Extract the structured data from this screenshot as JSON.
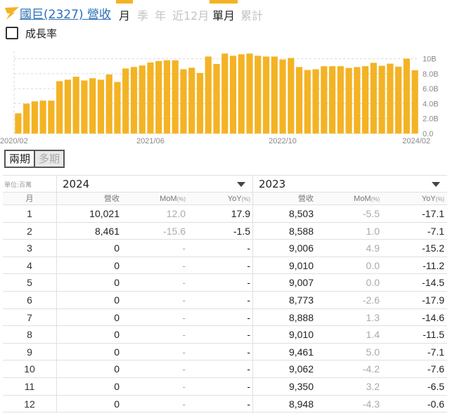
{
  "header": {
    "company": "國巨(2327) 營收",
    "tabs": [
      {
        "label": "月",
        "active": true
      },
      {
        "label": "季",
        "active": false
      },
      {
        "label": "年",
        "active": false
      },
      {
        "label": "近12月",
        "active": false
      },
      {
        "label": "單月",
        "active": true
      },
      {
        "label": "累計",
        "active": false
      }
    ]
  },
  "growth_toggle": {
    "label": "成長率",
    "checked": false
  },
  "chart_data": {
    "type": "bar",
    "title": "",
    "xlabel": "",
    "ylabel": "",
    "x_ticks": [
      "2020/02",
      "2021/06",
      "2022/10",
      "2024/02"
    ],
    "y_ticks": [
      "0.0",
      "2.0B",
      "4.0B",
      "6.0B",
      "8.0B",
      "10B"
    ],
    "ylim": [
      0,
      11000
    ],
    "unit": "百萬",
    "grid": true,
    "colors": {
      "bar": "#f4b324"
    },
    "x": [
      "2020/02",
      "2020/03",
      "2020/04",
      "2020/05",
      "2020/06",
      "2020/07",
      "2020/08",
      "2020/09",
      "2020/10",
      "2020/11",
      "2020/12",
      "2021/01",
      "2021/02",
      "2021/03",
      "2021/04",
      "2021/05",
      "2021/06",
      "2021/07",
      "2021/08",
      "2021/09",
      "2021/10",
      "2021/11",
      "2021/12",
      "2022/01",
      "2022/02",
      "2022/03",
      "2022/04",
      "2022/05",
      "2022/06",
      "2022/07",
      "2022/08",
      "2022/09",
      "2022/10",
      "2022/11",
      "2022/12",
      "2023/01",
      "2023/02",
      "2023/03",
      "2023/04",
      "2023/05",
      "2023/06",
      "2023/07",
      "2023/08",
      "2023/09",
      "2023/10",
      "2023/11",
      "2023/12",
      "2024/01",
      "2024/02"
    ],
    "values": [
      2700,
      4000,
      4300,
      4400,
      4400,
      7000,
      7200,
      7600,
      7100,
      7400,
      7200,
      7900,
      6900,
      8700,
      8900,
      9100,
      9500,
      9700,
      9800,
      9800,
      8600,
      8800,
      8100,
      10300,
      9300,
      10700,
      10400,
      10600,
      10700,
      10400,
      10300,
      10300,
      9900,
      10100,
      8900,
      8500,
      8600,
      9006,
      9010,
      9007,
      8773,
      8888,
      9010,
      9461,
      9062,
      9350,
      8948,
      10021,
      8461
    ]
  },
  "mode_toggle": {
    "options": [
      "兩期",
      "多期"
    ],
    "active": "兩期"
  },
  "table": {
    "unit_label": "單位:百萬",
    "year1": "2024",
    "year2": "2023",
    "headers": {
      "month": "月",
      "revenue": "營收",
      "mom": "MoM",
      "yoy": "YoY",
      "pct": "(%)"
    },
    "rows": [
      {
        "m": "1",
        "r1": "10,021",
        "mom1": "12.0",
        "yoy1": "17.9",
        "r2": "8,503",
        "mom2": "-5.5",
        "yoy2": "-17.1"
      },
      {
        "m": "2",
        "r1": "8,461",
        "mom1": "-15.6",
        "yoy1": "-1.5",
        "r2": "8,588",
        "mom2": "1.0",
        "yoy2": "-7.1"
      },
      {
        "m": "3",
        "r1": "0",
        "mom1": "-",
        "yoy1": "-",
        "r2": "9,006",
        "mom2": "4.9",
        "yoy2": "-15.2"
      },
      {
        "m": "4",
        "r1": "0",
        "mom1": "-",
        "yoy1": "-",
        "r2": "9,010",
        "mom2": "0.0",
        "yoy2": "-11.2"
      },
      {
        "m": "5",
        "r1": "0",
        "mom1": "-",
        "yoy1": "-",
        "r2": "9,007",
        "mom2": "0.0",
        "yoy2": "-14.5"
      },
      {
        "m": "6",
        "r1": "0",
        "mom1": "-",
        "yoy1": "-",
        "r2": "8,773",
        "mom2": "-2.6",
        "yoy2": "-17.9"
      },
      {
        "m": "7",
        "r1": "0",
        "mom1": "-",
        "yoy1": "-",
        "r2": "8,888",
        "mom2": "1.3",
        "yoy2": "-14.6"
      },
      {
        "m": "8",
        "r1": "0",
        "mom1": "-",
        "yoy1": "-",
        "r2": "9,010",
        "mom2": "1.4",
        "yoy2": "-11.5"
      },
      {
        "m": "9",
        "r1": "0",
        "mom1": "-",
        "yoy1": "-",
        "r2": "9,461",
        "mom2": "5.0",
        "yoy2": "-7.1"
      },
      {
        "m": "10",
        "r1": "0",
        "mom1": "-",
        "yoy1": "-",
        "r2": "9,062",
        "mom2": "-4.2",
        "yoy2": "-7.6"
      },
      {
        "m": "11",
        "r1": "0",
        "mom1": "-",
        "yoy1": "-",
        "r2": "9,350",
        "mom2": "3.2",
        "yoy2": "-6.5"
      },
      {
        "m": "12",
        "r1": "0",
        "mom1": "-",
        "yoy1": "-",
        "r2": "8,948",
        "mom2": "-4.3",
        "yoy2": "-0.6"
      }
    ]
  }
}
